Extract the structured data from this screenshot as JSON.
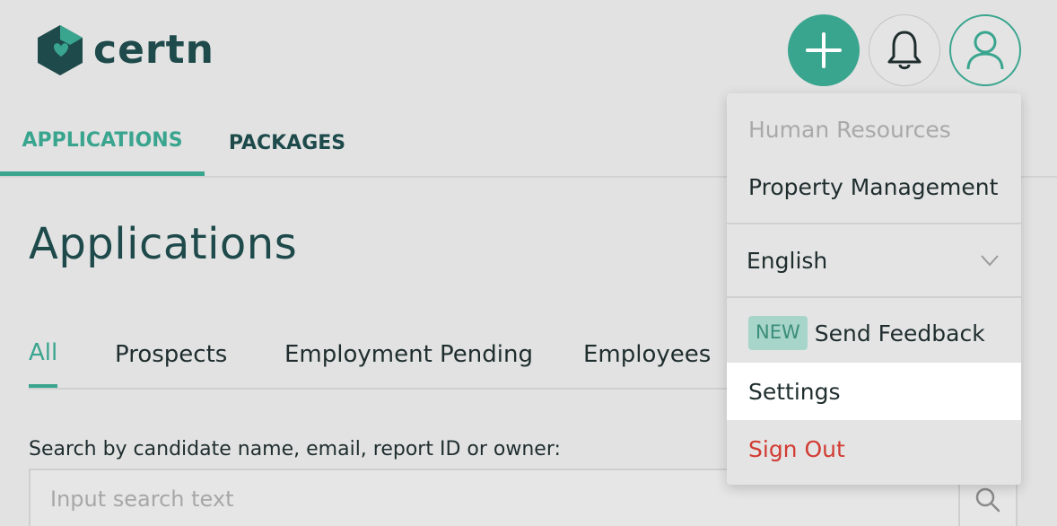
{
  "brand": {
    "name": "certn",
    "accent_color": "#3aa58f",
    "dark_color": "#1e4a4b"
  },
  "header": {
    "add_icon": "plus-icon",
    "bell_icon": "bell-icon",
    "user_icon": "user-icon"
  },
  "top_tabs": [
    {
      "label": "APPLICATIONS",
      "active": true
    },
    {
      "label": "PACKAGES",
      "active": false
    }
  ],
  "page_title": "Applications",
  "filter_tabs": [
    {
      "label": "All",
      "active": true
    },
    {
      "label": "Prospects",
      "active": false
    },
    {
      "label": "Employment Pending",
      "active": false
    },
    {
      "label": "Employees",
      "active": false
    }
  ],
  "search": {
    "label": "Search by candidate name, email, report ID or owner:",
    "placeholder": "Input search text",
    "value": "",
    "icon": "search-icon"
  },
  "dropdown": {
    "team_options": [
      {
        "label": "Human Resources",
        "disabled": true
      },
      {
        "label": "Property Management",
        "disabled": false
      }
    ],
    "language": {
      "value": "English",
      "icon": "chevron-down-icon"
    },
    "feedback": {
      "badge": "NEW",
      "label": "Send Feedback"
    },
    "settings": "Settings",
    "sign_out": "Sign Out",
    "danger_color": "#d23b32"
  }
}
